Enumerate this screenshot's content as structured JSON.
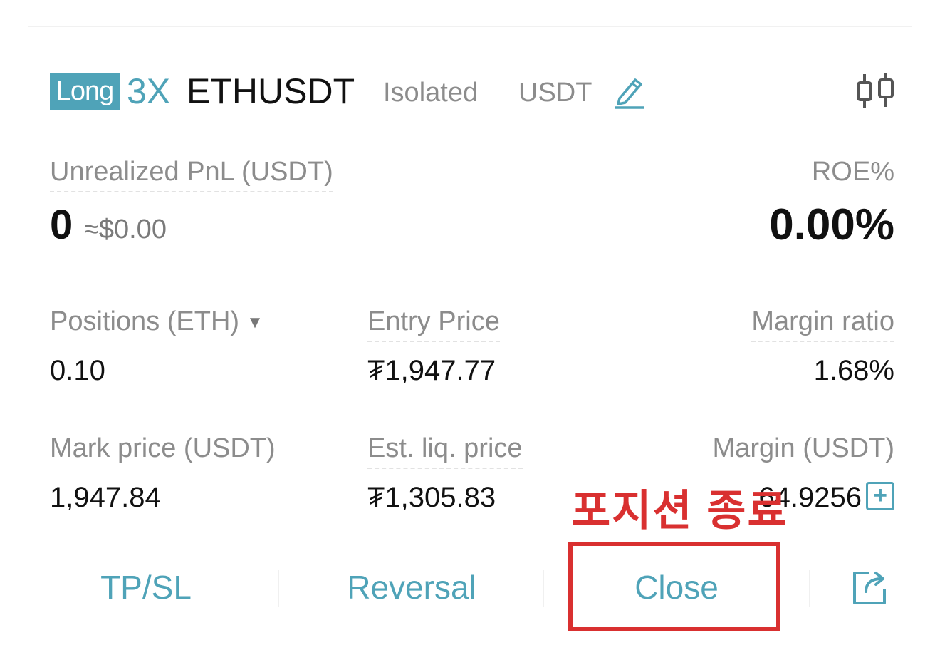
{
  "header": {
    "side": "Long",
    "leverage": "3X",
    "symbol": "ETHUSDT",
    "margin_mode": "Isolated",
    "margin_coin": "USDT",
    "edit_icon": "edit-pencil-icon",
    "chart_icon": "candlestick-chart-icon"
  },
  "pnl": {
    "label": "Unrealized PnL (USDT)",
    "value": "0",
    "approx": "≈$0.00"
  },
  "roe": {
    "label": "ROE%",
    "value": "0.00%"
  },
  "stats": {
    "positions": {
      "label": "Positions (ETH)",
      "value": "0.10"
    },
    "entry_price": {
      "label": "Entry Price",
      "value": "₮1,947.77"
    },
    "margin_ratio": {
      "label": "Margin ratio",
      "value": "1.68%"
    },
    "mark_price": {
      "label": "Mark price (USDT)",
      "value": "1,947.84"
    },
    "est_liq_price": {
      "label": "Est. liq. price",
      "value": "₮1,305.83"
    },
    "margin": {
      "label": "Margin (USDT)",
      "value": "64.9256"
    }
  },
  "actions": {
    "tpsl": "TP/SL",
    "reversal": "Reversal",
    "close": "Close",
    "share_icon": "share-icon"
  },
  "annotation": {
    "text": "포지션 종료"
  },
  "colors": {
    "accent": "#4fa3b8",
    "annotation": "#d93030",
    "muted": "#8c8c8c"
  }
}
